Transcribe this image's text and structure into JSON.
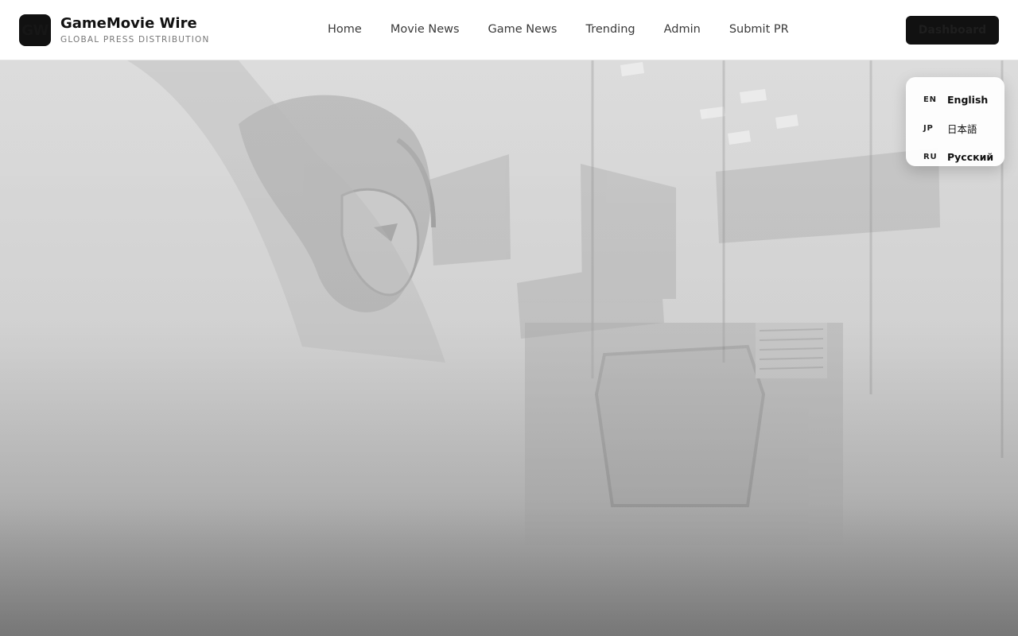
{
  "brand": {
    "logo_text": "GW",
    "title": "GameMovie Wire",
    "subtitle": "GLOBAL PRESS DISTRIBUTION"
  },
  "nav": {
    "items": [
      {
        "label": "Home"
      },
      {
        "label": "Movie News"
      },
      {
        "label": "Game News"
      },
      {
        "label": "Trending"
      },
      {
        "label": "Admin"
      },
      {
        "label": "Submit PR"
      }
    ]
  },
  "header": {
    "dashboard_label": "Dashboard"
  },
  "language_menu": {
    "items": [
      {
        "code": "EN",
        "name": "English"
      },
      {
        "code": "JP",
        "name": "日本語"
      },
      {
        "code": "RU",
        "name": "Русский"
      }
    ]
  },
  "colors": {
    "accent": "#111111",
    "header_bg": "#ffffff"
  }
}
